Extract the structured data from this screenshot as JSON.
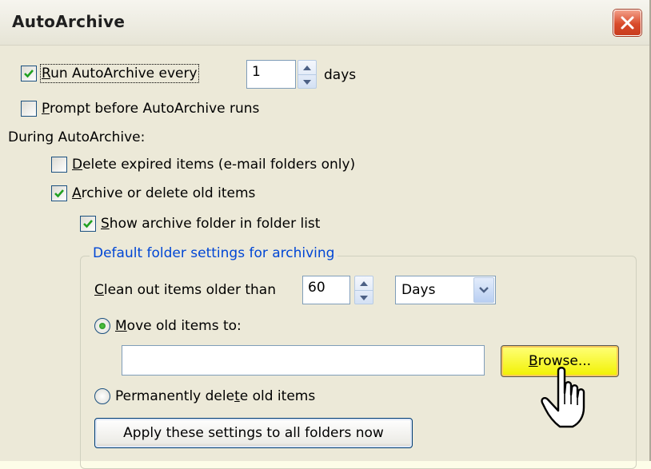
{
  "dialog": {
    "title": "AutoArchive"
  },
  "run_autoarchive": {
    "label_prefix": "R",
    "label_rest": "un AutoArchive every",
    "checked": true,
    "value": "1",
    "unit": "days"
  },
  "prompt_before": {
    "label_prefix": "P",
    "label_rest": "rompt before AutoArchive runs",
    "checked": false
  },
  "during_label": "During AutoArchive:",
  "delete_expired": {
    "label_prefix": "D",
    "label_rest": "elete expired items (e-mail folders only)",
    "checked": false
  },
  "archive_old": {
    "label_prefix": "A",
    "label_rest": "rchive or delete old items",
    "checked": true
  },
  "show_folder": {
    "label_prefix": "S",
    "label_rest": "how archive folder in folder list",
    "checked": true
  },
  "defaults_group": {
    "legend": "Default folder settings for archiving"
  },
  "clean_out": {
    "label_prefix": "C",
    "label_rest": "lean out items older than",
    "value": "60",
    "period": "Days"
  },
  "move_old": {
    "label_prefix": "M",
    "label_rest": "ove old items to:",
    "selected": true,
    "path": ""
  },
  "browse_button": {
    "label_prefix": "B",
    "label_rest": "rowse..."
  },
  "permanently_delete": {
    "label_a": "Permanently dele",
    "label_u": "t",
    "label_b": "e old items",
    "selected": false
  },
  "apply_button": {
    "label": "Apply these settings to all folders now"
  },
  "colors": {
    "legend": "#0046d5",
    "browse_highlight": "#f1f100",
    "check": "#21a121",
    "close": "#d94b2b"
  }
}
